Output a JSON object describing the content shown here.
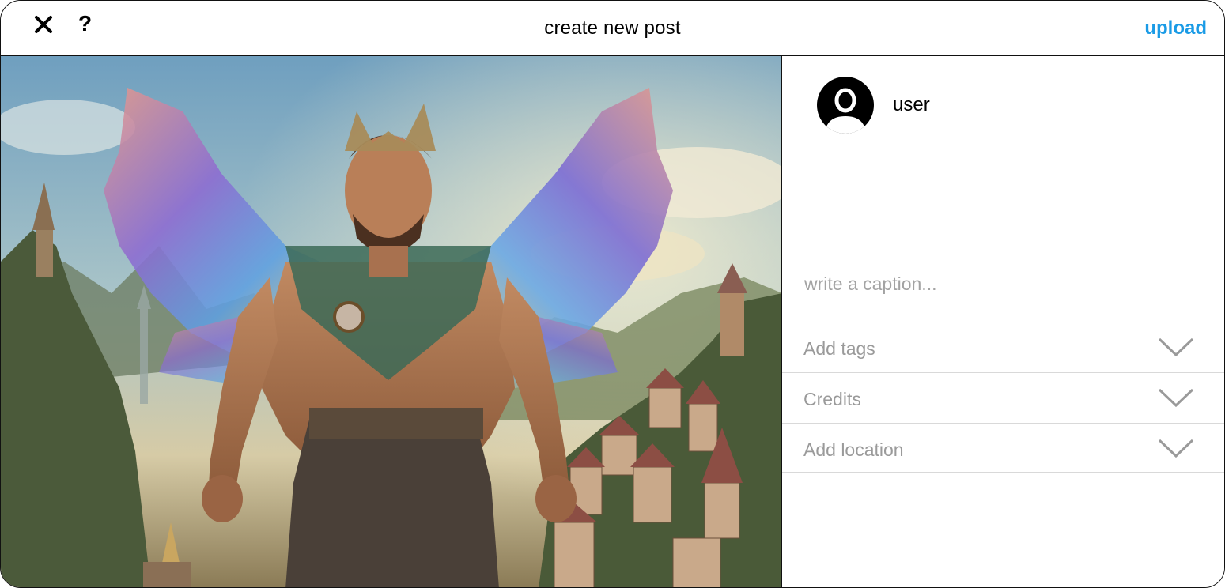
{
  "header": {
    "title": "create new post",
    "upload_label": "upload",
    "help_label": "?",
    "close_icon": "close-icon",
    "accent_color": "#1a9be6"
  },
  "post": {
    "image_description_icon": "fantasy-image"
  },
  "user": {
    "name": "user",
    "avatar_icon": "user-avatar-icon"
  },
  "caption": {
    "placeholder": "write a caption..."
  },
  "options": [
    {
      "label": "Add tags",
      "icon": "chevron-down-icon"
    },
    {
      "label": "Credits",
      "icon": "chevron-down-icon"
    },
    {
      "label": "Add location",
      "icon": "chevron-down-icon"
    }
  ]
}
